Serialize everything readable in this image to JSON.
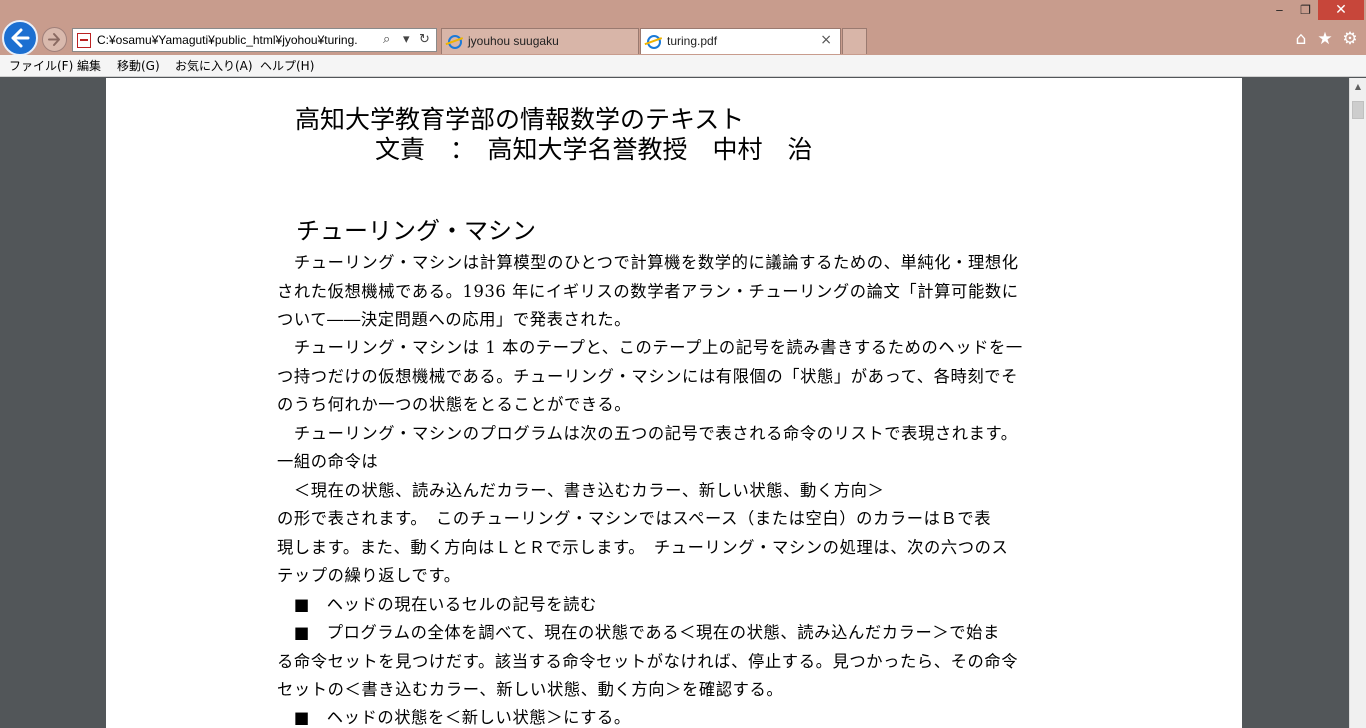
{
  "window": {
    "minimize": "‒",
    "maximize": "❐",
    "close": "✕"
  },
  "address_bar": {
    "url": "C:¥osamu¥Yamaguti¥public_html¥jyohou¥turing.",
    "search_glyph": "⌕",
    "dropdown_glyph": "▾",
    "refresh_glyph": "↻"
  },
  "tabs": [
    {
      "label": "jyouhou suugaku"
    },
    {
      "label": "turing.pdf",
      "close": "×"
    }
  ],
  "toolbar_icons": {
    "home": "⌂",
    "favorites": "★",
    "tools": "⚙"
  },
  "menu": {
    "items": [
      "ファイル(F)",
      "編集",
      "移動(G)",
      "お気に入り(A)",
      "ヘルプ(H)"
    ]
  },
  "document": {
    "title": "高知大学教育学部の情報数学のテキスト",
    "author_line": "文責　：　高知大学名誉教授　中村　治",
    "heading": "チューリング・マシン",
    "lines": [
      "　チューリング・マシンは計算模型のひとつで計算機を数学的に議論するための、単純化・理想化",
      "された仮想機械である。1936 年にイギリスの数学者アラン・チューリングの論文「計算可能数に",
      "ついて――決定問題への応用」で発表された。",
      "　チューリング・マシンは 1 本のテープと、このテープ上の記号を読み書きするためのヘッドを一",
      "つ持つだけの仮想機械である。チューリング・マシンには有限個の「状態」があって、各時刻でそ",
      "のうち何れか一つの状態をとることができる。",
      "　チューリング・マシンのプログラムは次の五つの記号で表される命令のリストで表現されます。",
      "一組の命令は",
      "　＜現在の状態、読み込んだカラー、書き込むカラー、新しい状態、動く方向＞",
      "の形で表されます。　このチューリング・マシンではスペース（または空白）のカラーはＢで表",
      "現します。また、動く方向はＬとＲで示します。　チューリング・マシンの処理は、次の六つのス",
      "テップの繰り返しです。",
      "　■　ヘッドの現在いるセルの記号を読む",
      "　■　プログラムの全体を調べて、現在の状態である＜現在の状態、読み込んだカラー＞で始ま",
      "る命令セットを見つけだす。該当する命令セットがなければ、停止する。見つかったら、その命令",
      "セットの＜書き込むカラー、新しい状態、動く方向＞を確認する。",
      "　■　ヘッドの状態を＜新しい状態＞にする。"
    ]
  }
}
